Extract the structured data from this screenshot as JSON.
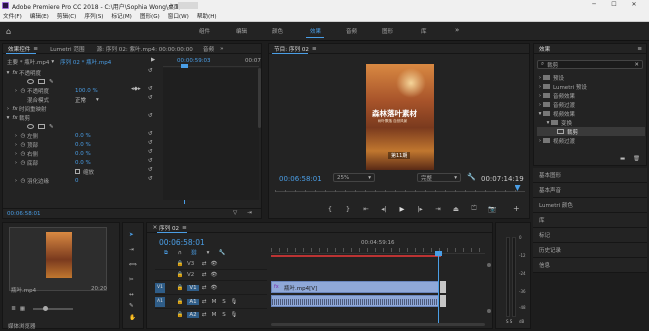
{
  "titlebar": {
    "app_icon": "premiere-pr-icon",
    "title": "Adobe Premiere Pro CC 2018 - C:\\用户\\Sophia Wong\\桌面"
  },
  "menu": [
    "文件(F)",
    "编辑(E)",
    "剪辑(C)",
    "序列(S)",
    "标记(M)",
    "图形(G)",
    "窗口(W)",
    "帮助(H)"
  ],
  "workspaces": [
    "组件",
    "编辑",
    "颜色",
    "效果",
    "音频",
    "图形",
    "库"
  ],
  "workspace_active": "效果",
  "effect_controls": {
    "tabs": [
      "效果控件",
      "Lumetri 范围",
      "源: 序列 02: 紫叶.mp4: 00:00:00:00",
      "音频"
    ],
    "master": "主要 * 瓶叶.mp4",
    "sequence": "序列 02 * 瓶叶.mp4",
    "timecode_start": "00:00:59:03",
    "timecode_end": "00:07",
    "rows": [
      {
        "label": "不透明度",
        "indent": 0,
        "value": "",
        "fx": true
      },
      {
        "label": "不透明度",
        "indent": 1,
        "value": "100.0 %"
      },
      {
        "label": "混合模式",
        "indent": 1,
        "value": "正常"
      },
      {
        "label": "时间重映射",
        "indent": 0,
        "value": "",
        "fx": true
      },
      {
        "label": "裁剪",
        "indent": 0,
        "value": "",
        "fx": true
      },
      {
        "label": "左侧",
        "indent": 1,
        "value": "0.0 %"
      },
      {
        "label": "顶部",
        "indent": 1,
        "value": "0.0 %"
      },
      {
        "label": "右侧",
        "indent": 1,
        "value": "0.0 %"
      },
      {
        "label": "底部",
        "indent": 1,
        "value": "0.0 %"
      },
      {
        "label": "缩放",
        "indent": 1,
        "value": "缩放"
      },
      {
        "label": "羽化边缘",
        "indent": 1,
        "value": "0"
      }
    ],
    "bottom_timecode": "00:06:58:01"
  },
  "program": {
    "tab": "节目: 序列 02",
    "poster_title": "森林落叶素材",
    "poster_sub": "树叶飘落 自然风景",
    "poster_badge": "第11期",
    "timecode": "00:06:58:01",
    "zoom": "25%",
    "quality": "完整",
    "duration": "00:07:14:19",
    "playhead": 0.97
  },
  "effects_panel": {
    "title": "效果",
    "search_value": "裁剪",
    "tree": [
      {
        "label": "预设",
        "indent": 0
      },
      {
        "label": "Lumetri 预设",
        "indent": 0
      },
      {
        "label": "音频效果",
        "indent": 0
      },
      {
        "label": "音频过渡",
        "indent": 0
      },
      {
        "label": "视频效果",
        "indent": 0
      },
      {
        "label": "变换",
        "indent": 1
      },
      {
        "label": "裁剪",
        "indent": 2,
        "selected": true
      },
      {
        "label": "视频过渡",
        "indent": 0
      }
    ],
    "sections": [
      "基本图形",
      "基本声音",
      "Lumetri 颜色",
      "库",
      "标记",
      "历史记录",
      "信息"
    ]
  },
  "project": {
    "clip_name": "瓶叶.mp4",
    "clip_duration": "20:20",
    "footer": "媒体浏览器"
  },
  "timeline": {
    "tab": "序列 02",
    "timecode": "00:06:58:01",
    "ruler_time": "00:04:59:16",
    "tracks_v": [
      "V3",
      "V2",
      "V1"
    ],
    "tracks_a": [
      "A1",
      "A2"
    ],
    "clip_label": "瓶叶.mp4[V]",
    "playhead": 0.62
  },
  "audio_meter": {
    "labels": [
      "0",
      "-12",
      "-24",
      "-36",
      "-48",
      "dB"
    ]
  }
}
